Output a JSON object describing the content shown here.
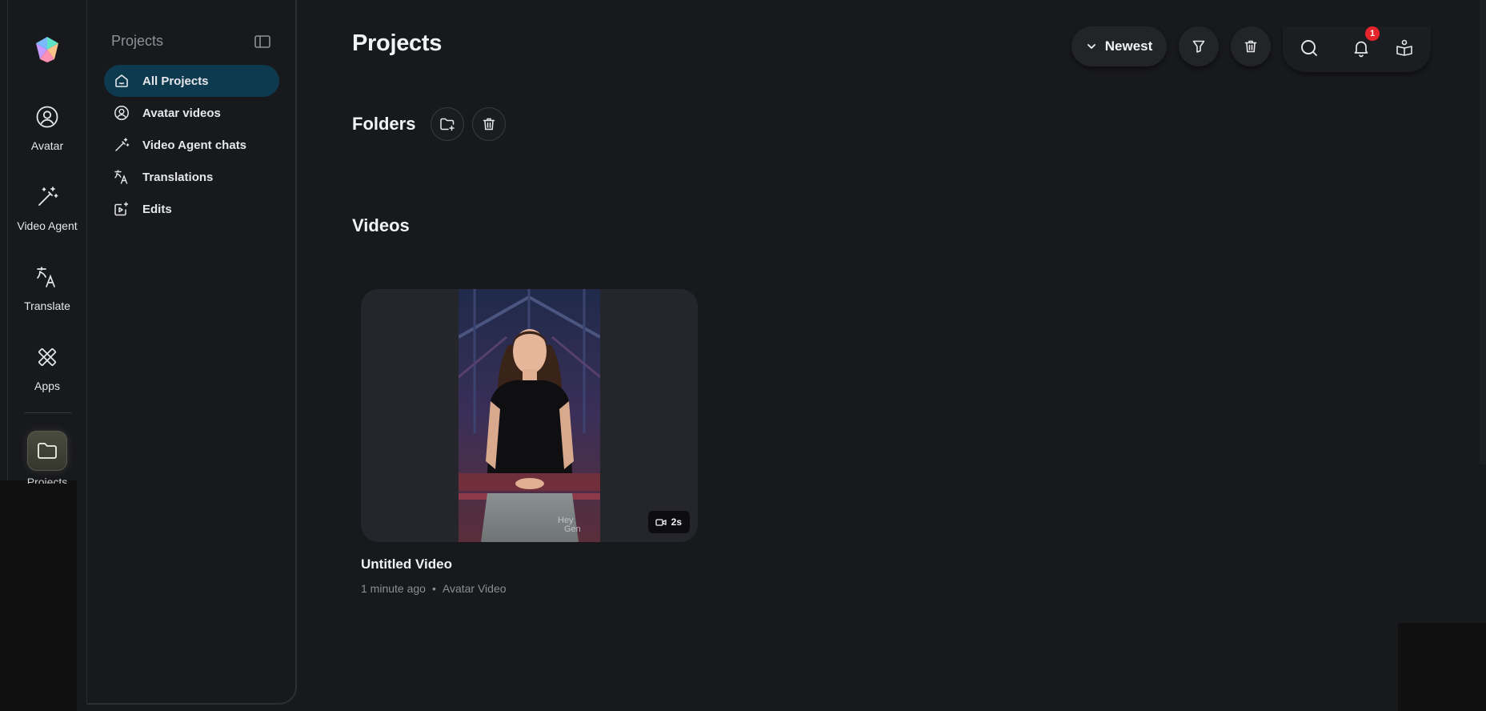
{
  "rail": {
    "items": [
      {
        "label": "Avatar",
        "icon": "avatar-icon"
      },
      {
        "label": "Video Agent",
        "icon": "magic-wand-icon"
      },
      {
        "label": "Translate",
        "icon": "translate-icon"
      },
      {
        "label": "Apps",
        "icon": "apps-icon"
      }
    ],
    "projects_label": "Projects"
  },
  "panel": {
    "title": "Projects",
    "nav": [
      {
        "label": "All Projects",
        "icon": "home-icon",
        "active": true
      },
      {
        "label": "Avatar videos",
        "icon": "avatar-icon"
      },
      {
        "label": "Video Agent chats",
        "icon": "magic-wand-icon"
      },
      {
        "label": "Translations",
        "icon": "translate-icon"
      },
      {
        "label": "Edits",
        "icon": "video-edit-icon"
      }
    ]
  },
  "main": {
    "title": "Projects",
    "sort_label": "Newest",
    "notification_count": "1",
    "folders_title": "Folders",
    "videos_title": "Videos"
  },
  "videos": [
    {
      "title": "Untitled Video",
      "time": "1 minute ago",
      "separator": "•",
      "type": "Avatar Video",
      "duration": "2s"
    }
  ],
  "colors": {
    "background": "#18191d",
    "active_nav": "#0e3a4f",
    "badge": "#e5252b",
    "card": "#25262b"
  }
}
